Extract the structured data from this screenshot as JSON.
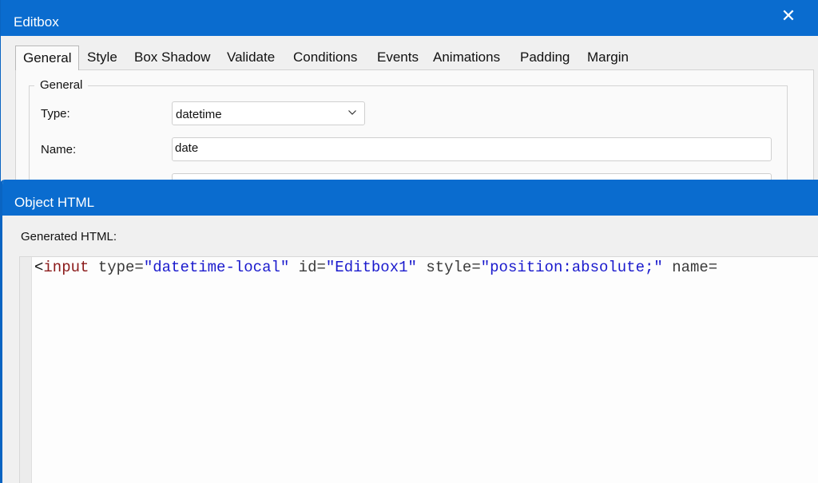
{
  "editbox_dialog": {
    "title": "Editbox",
    "close_glyph": "✕",
    "tabs": [
      {
        "label": "General",
        "active": true
      },
      {
        "label": "Style"
      },
      {
        "label": "Box Shadow"
      },
      {
        "label": "Validate"
      },
      {
        "label": "Conditions"
      },
      {
        "label": "Events"
      },
      {
        "label": "Animations"
      },
      {
        "label": "Padding"
      },
      {
        "label": "Margin"
      }
    ],
    "group_title": "General",
    "type_label": "Type:",
    "type_value": "datetime",
    "name_label": "Name:",
    "name_value": "date",
    "third_value": ""
  },
  "object_html_dialog": {
    "title": "Object HTML",
    "generated_label": "Generated HTML:",
    "code": {
      "open": "<",
      "tag": "input",
      "attr1": " type=",
      "val1": "\"datetime-local\"",
      "attr2": " id=",
      "val2": "\"Editbox1\"",
      "attr3": " style=",
      "val3": "\"position:absolute;\"",
      "attr4": " name="
    }
  },
  "colors": {
    "titlebar": "#0a6ccf",
    "code_tag": "#8b1a1a",
    "code_value": "#1a1acd"
  }
}
